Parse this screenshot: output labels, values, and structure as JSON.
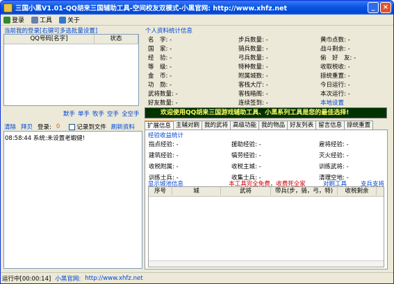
{
  "window": {
    "title": "三国小黑V1.01-QQ胡来三国辅助工具-空间校友双模式-小黑官网: http://www.xhfz.net"
  },
  "menu": {
    "login": "登录",
    "tools": "工具",
    "about": "关于"
  },
  "accounts": {
    "title": "当前我的登录[右键可多选批量设置]",
    "col_qq": "QQ号码[名字]",
    "col_status": "状态"
  },
  "quick_links": [
    "默手",
    "单手",
    "牧手",
    "空手",
    "全空手"
  ],
  "log_toolbar": {
    "clear": "清除",
    "tail": "拜贝",
    "login_label": "登录:",
    "login_count": "0",
    "record_file": "记录到文件",
    "refresh": "刷新资料"
  },
  "log": {
    "line1": "08:58:44 系统:未设置老蝦健!"
  },
  "stats": {
    "title": "个人资料统计信息",
    "left": [
      {
        "label": "名　字:",
        "value": "-"
      },
      {
        "label": "国　家:",
        "value": "-"
      },
      {
        "label": "经　验:",
        "value": "-"
      },
      {
        "label": "等　级:",
        "value": "-"
      },
      {
        "label": "金　币:",
        "value": "-"
      },
      {
        "label": "功　勋:",
        "value": "-"
      },
      {
        "label": "武将数量:",
        "value": "-"
      },
      {
        "label": "好友数量:",
        "value": "-"
      }
    ],
    "mid": [
      {
        "label": "步兵数量:",
        "value": "-"
      },
      {
        "label": "骑兵数量:",
        "value": "-"
      },
      {
        "label": "弓兵数量:",
        "value": "-"
      },
      {
        "label": "特种数量:",
        "value": "-"
      },
      {
        "label": "附属城数:",
        "value": "-"
      },
      {
        "label": "客栈大厅:",
        "value": "-"
      },
      {
        "label": "客栈暗阁:",
        "value": "-"
      },
      {
        "label": "连续签到:",
        "value": "-"
      }
    ],
    "right": [
      {
        "label": "黄巾点数:",
        "value": "-"
      },
      {
        "label": "战斗剩余:",
        "value": "-"
      },
      {
        "label": "偷　好　友:",
        "value": "-"
      },
      {
        "label": "收取税收:",
        "value": "-"
      },
      {
        "label": "掠统重置:",
        "value": "-"
      },
      {
        "label": "今日运行:",
        "value": "-"
      },
      {
        "label": "本次运行:",
        "value": "-"
      },
      {
        "label": "本地设置",
        "value": ""
      }
    ]
  },
  "banner": "欢迎使用QQ胡来三国游戏辅助工具、小黑系列工具是您的最佳选择!",
  "tabs": [
    "扩展信息",
    "主辅对刷",
    "我的武将",
    "高级功能",
    "我的物品",
    "好友列表",
    "留言信息",
    "掠统重置"
  ],
  "ext": {
    "sub_title": "经验收益统计",
    "rows": [
      [
        {
          "label": "指点经验:",
          "value": "-"
        },
        {
          "label": "援助经验:",
          "value": "-"
        },
        {
          "label": "雇将经验:",
          "value": "-"
        }
      ],
      [
        {
          "label": "建筑经验:",
          "value": "-"
        },
        {
          "label": "犒劳经验:",
          "value": "-"
        },
        {
          "label": "灭火经验:",
          "value": "-"
        }
      ],
      [
        {
          "label": "收税附属:",
          "value": "-"
        },
        {
          "label": "收税主城:",
          "value": "-"
        },
        {
          "label": "训练武将:",
          "value": "-"
        }
      ],
      [
        {
          "label": "训练士兵:",
          "value": "-"
        },
        {
          "label": "收集士兵:",
          "value": "-"
        },
        {
          "label": "清理空地:",
          "value": "-"
        }
      ]
    ],
    "show_city": "显示城池信息",
    "free_notice": "本工具完全免费，收费死全家",
    "brush_tool": "对刷工具",
    "support": "支兵支将",
    "grid_cols": [
      "序号",
      "城",
      "武将",
      "带兵(步，骑，弓，特)",
      "收税剩余"
    ]
  },
  "status": {
    "running": "运行中[00:00:14]",
    "site_label": "小黑官网:",
    "site_url": "http://www.xhfz.net"
  }
}
